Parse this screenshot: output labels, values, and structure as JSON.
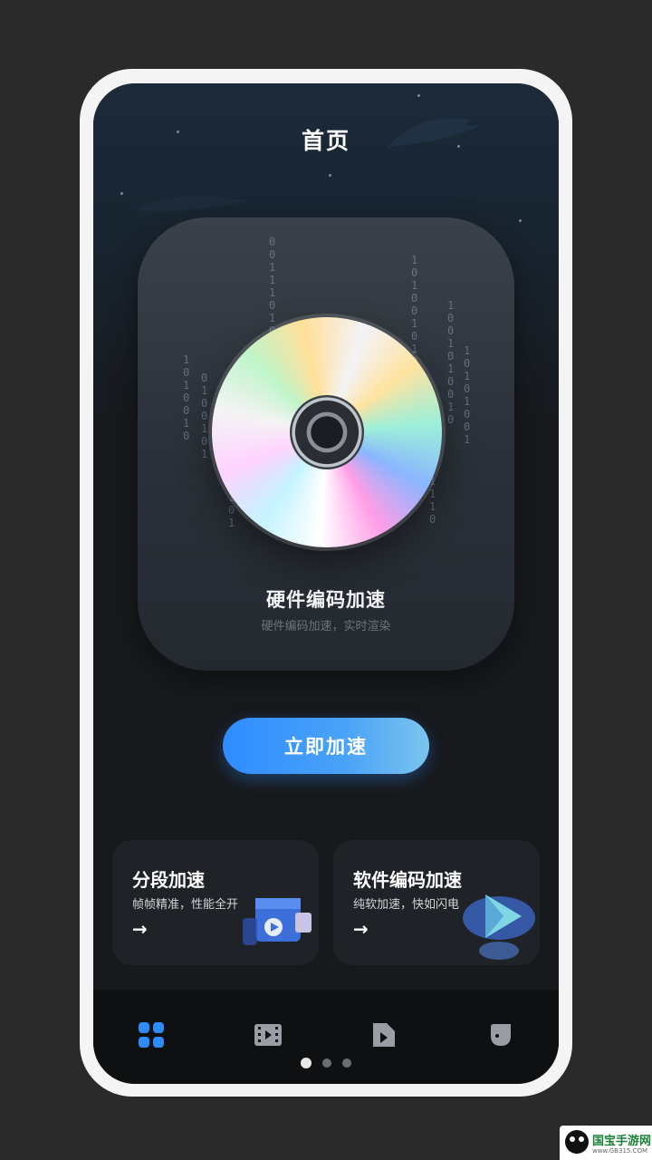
{
  "header": {
    "title": "首页"
  },
  "hero": {
    "title": "硬件编码加速",
    "subtitle": "硬件编码加速，实时渲染",
    "binary_columns": [
      "1010010",
      "0100101",
      "01100100101",
      "001110100101010",
      "101001010",
      "10100101001",
      "0101001110",
      "1001010010",
      "10101001"
    ]
  },
  "primary_action": {
    "label": "立即加速"
  },
  "features": [
    {
      "title": "分段加速",
      "subtitle": "帧帧精准，性能全开"
    },
    {
      "title": "软件编码加速",
      "subtitle": "纯软加速，快如闪电"
    }
  ],
  "bottom_nav": {
    "items": [
      {
        "icon": "grid-icon",
        "active": true
      },
      {
        "icon": "video-film-icon",
        "active": false
      },
      {
        "icon": "video-file-icon",
        "active": false
      },
      {
        "icon": "profile-icon",
        "active": false
      }
    ]
  },
  "pager": {
    "count": 3,
    "active_index": 0
  },
  "watermark": {
    "text": "国宝手游网",
    "url": "www.GB315.COM"
  },
  "colors": {
    "accent": "#2f8cff",
    "screen_bg": "#17191c",
    "nav_bg": "#0f1012",
    "active_icon": "#2f8cff",
    "inactive_icon": "#9a9ea4"
  }
}
